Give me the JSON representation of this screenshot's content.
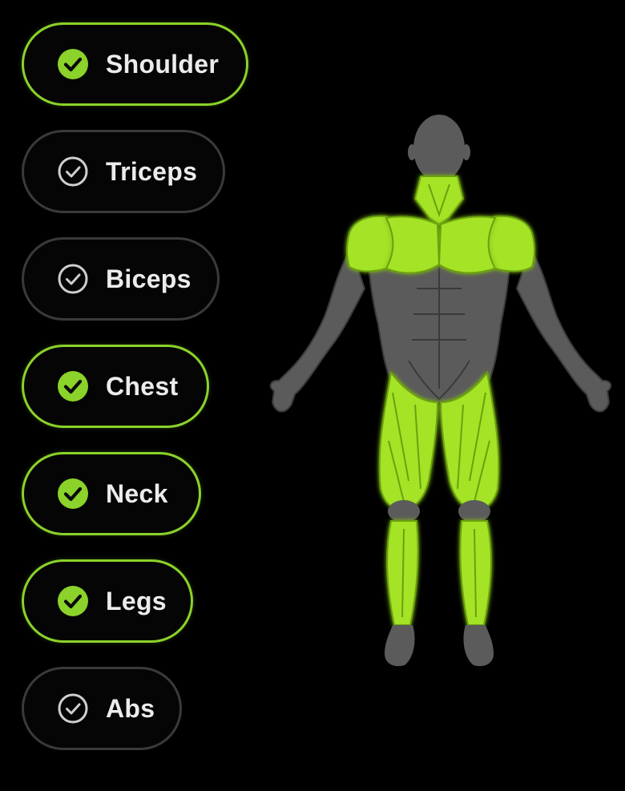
{
  "colors": {
    "background": "#000000",
    "accent": "#8bd22a",
    "muscle_active": "#a4e325",
    "body_inactive": "#5b5b5b",
    "chip_border_inactive": "#3a3a3a",
    "label": "#ececec"
  },
  "muscle_groups": [
    {
      "label": "Shoulder",
      "selected": true,
      "icon": "check-circle-filled-icon"
    },
    {
      "label": "Triceps",
      "selected": false,
      "icon": "check-circle-outline-icon"
    },
    {
      "label": "Biceps",
      "selected": false,
      "icon": "check-circle-outline-icon"
    },
    {
      "label": "Chest",
      "selected": true,
      "icon": "check-circle-filled-icon"
    },
    {
      "label": "Neck",
      "selected": true,
      "icon": "check-circle-filled-icon"
    },
    {
      "label": "Legs",
      "selected": true,
      "icon": "check-circle-filled-icon"
    },
    {
      "label": "Abs",
      "selected": false,
      "icon": "check-circle-outline-icon"
    }
  ],
  "body_map": {
    "highlighted": [
      "Shoulder",
      "Chest",
      "Neck",
      "Legs"
    ]
  }
}
